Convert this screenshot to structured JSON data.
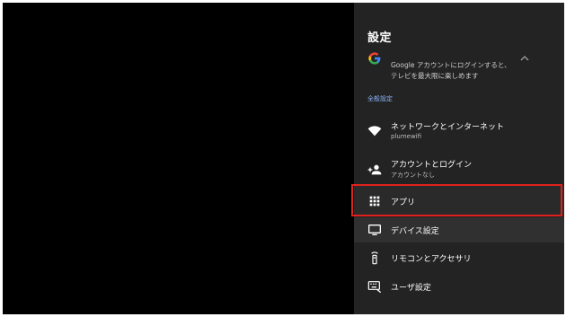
{
  "panel": {
    "title": "設定"
  },
  "account": {
    "line1": "Google アカウントにログインすると、",
    "line2": "テレビを最大限に楽しめます",
    "icon": "google-g-icon"
  },
  "section_header": "全般設定",
  "menu": {
    "network": {
      "title": "ネットワークとインターネット",
      "subtitle": "plumewifi",
      "icon": "wifi-icon"
    },
    "account": {
      "title": "アカウントとログイン",
      "subtitle": "アカウントなし",
      "icon": "add-person-icon"
    },
    "apps": {
      "title": "アプリ",
      "icon": "apps-grid-icon"
    },
    "device": {
      "title": "デバイス設定",
      "icon": "tv-icon"
    },
    "remote": {
      "title": "リモコンとアクセサリ",
      "icon": "remote-icon"
    },
    "user": {
      "title": "ユーザ設定",
      "icon": "keyboard-icon"
    }
  },
  "colors": {
    "panel_bg": "#232323",
    "highlight_border": "#e0211c",
    "section_header": "#8ab4f8"
  }
}
